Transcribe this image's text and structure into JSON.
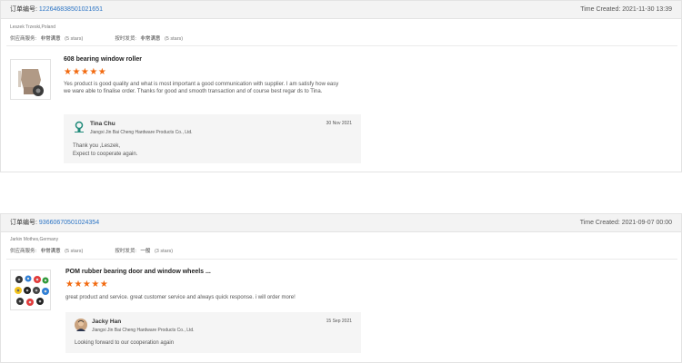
{
  "orders": [
    {
      "order_label": "订单编号:",
      "order_number": "122646838501021651",
      "time_created": "Time Created: 2021-11-30 13:39",
      "buyer": "Leszek Trzeski,Poland",
      "supplier_service_label": "供应商服务:",
      "supplier_service_value": "非常满意",
      "supplier_service_stars": "(5 stars)",
      "ontime_label": "按时发货:",
      "ontime_value": "非常满意",
      "ontime_stars": "(5 stars)",
      "product_title": "608 bearing window roller",
      "product_stars": "★★★★★",
      "review_text": "Yes product is good quality and what is most important a good communication with supplier. I am satisfy how easy we ware able to finalise order. Thanks for good and smooth transaction and of course best regar ds to Tina.",
      "reply": {
        "name": "Tina Chu",
        "company": "Jiangxi Jin Bai Cheng Hardware Products Co., Ltd.",
        "date": "30 Nov 2021",
        "text_line1": "Thank you ,Leszek,",
        "text_line2": "Expect to cooperate again."
      }
    },
    {
      "order_label": "订单编号:",
      "order_number": "93660670501024354",
      "time_created": "Time Created: 2021-09-07 00:00",
      "buyer": "Jarkin Mothes,Germany",
      "supplier_service_label": "供应商服务:",
      "supplier_service_value": "非常满意",
      "supplier_service_stars": "(5 stars)",
      "ontime_label": "按时发货:",
      "ontime_value": "一般",
      "ontime_stars": "(3 stars)",
      "product_title": "POM rubber bearing door and window wheels ...",
      "product_stars": "★★★★★",
      "review_text": "great product and service. great customer service and always quick response. i will order more!",
      "reply": {
        "name": "Jacky Han",
        "company": "Jiangxi Jin Bai Cheng Hardware Products Co., Ltd.",
        "date": "15 Sep 2021",
        "text_line1": "Looking forward to our cooperation again"
      }
    }
  ],
  "colors": {
    "accent_link": "#2a73c4",
    "star": "#f26a10",
    "header_bg": "#f3f3f3"
  }
}
